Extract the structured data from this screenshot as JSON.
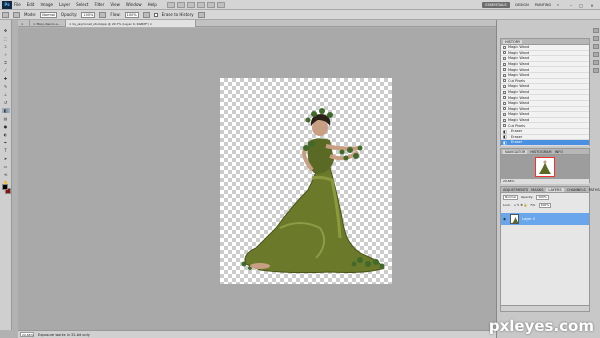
{
  "menubar": {
    "logo": "Ps",
    "items": [
      "File",
      "Edit",
      "Image",
      "Layer",
      "Select",
      "Filter",
      "View",
      "Window",
      "Help"
    ],
    "workspaces": {
      "essentials": "ESSENTIALS",
      "design": "DESIGN",
      "painting": "PAINTING",
      "more": "»"
    },
    "window_controls": {
      "min": "–",
      "max": "□",
      "close": "×"
    }
  },
  "options": {
    "mode_label": "Mode:",
    "mode_value": "Normal",
    "opacity_label": "Opacity:",
    "opacity_value": "100%",
    "flow_label": "Flow:",
    "flow_value": "100%",
    "erase_history": "Erase to History"
  },
  "tabs": [
    {
      "label": "×"
    },
    {
      "label": "× Mary-diecon-s..."
    },
    {
      "label": "× by_jaymonet_stockppp @ 29.7% (Layer 0, RGB/8*) ×"
    }
  ],
  "statusbar": {
    "zoom": "29.68%",
    "info": "Exposure works in 32-bit only"
  },
  "panels": {
    "history_title": "HISTORY",
    "history_items": [
      {
        "label": "Magic Wand"
      },
      {
        "label": "Magic Wand"
      },
      {
        "label": "Magic Wand"
      },
      {
        "label": "Magic Wand"
      },
      {
        "label": "Magic Wand"
      },
      {
        "label": "Magic Wand"
      },
      {
        "label": "Cut Pixels"
      },
      {
        "label": "Magic Wand"
      },
      {
        "label": "Magic Wand"
      },
      {
        "label": "Magic Wand"
      },
      {
        "label": "Magic Wand"
      },
      {
        "label": "Magic Wand"
      },
      {
        "label": "Magic Wand"
      },
      {
        "label": "Magic Wand"
      },
      {
        "label": "Cut Pixels"
      },
      {
        "label": "Eraser"
      },
      {
        "label": "Eraser"
      },
      {
        "label": "Eraser"
      }
    ],
    "navigator_tabs": [
      "NAVIGATOR",
      "HISTOGRAM",
      "INFO"
    ],
    "navigator_zoom": "29.68%",
    "layers_tabs": [
      "ADJUSTMENTS",
      "MASKS",
      "LAYERS",
      "CHANNELS",
      "PATHS"
    ],
    "blend_mode": "Normal",
    "opacity_label": "Opacity:",
    "opacity_value": "100%",
    "lock_label": "Lock:",
    "fill_label": "Fill:",
    "fill_value": "100%",
    "layer_name": "Layer 0"
  },
  "watermark": "pxleyes.com",
  "colors": {
    "accent": "#4a90e2",
    "background": "#b2b2b2",
    "layer_selected": "#6aa6ec"
  }
}
